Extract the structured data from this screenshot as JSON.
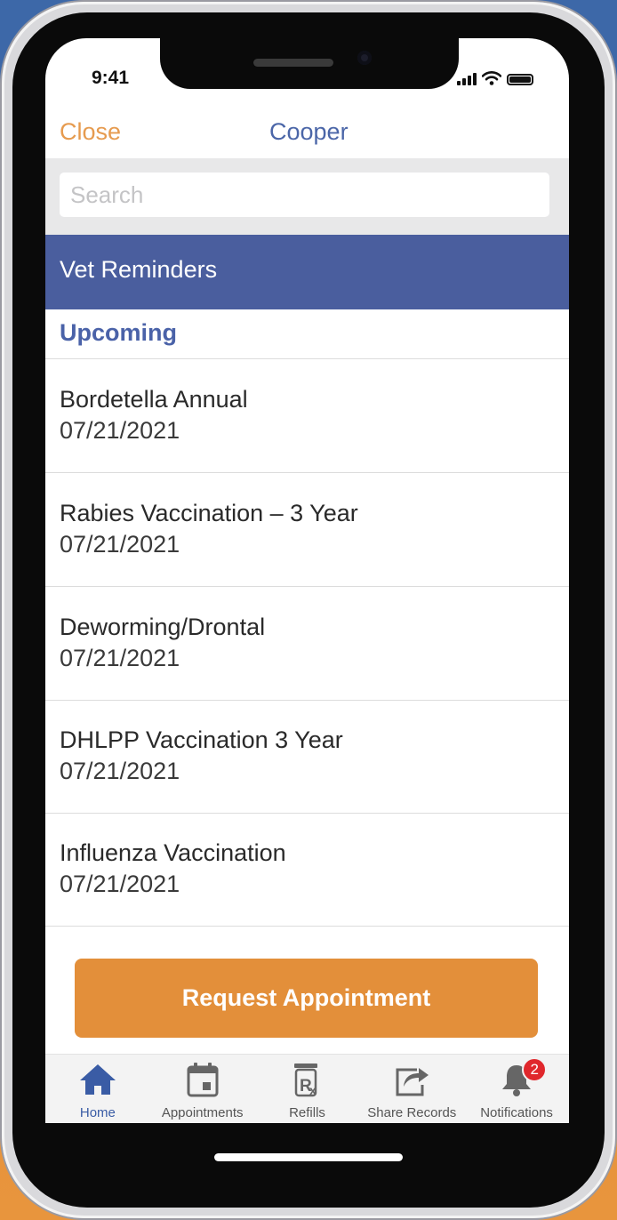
{
  "status_bar": {
    "time": "9:41"
  },
  "nav": {
    "close_label": "Close",
    "title": "Cooper"
  },
  "search": {
    "placeholder": "Search",
    "value": ""
  },
  "section": {
    "title": "Vet Reminders",
    "subheader": "Upcoming"
  },
  "reminders": [
    {
      "title": "Bordetella Annual",
      "date": "07/21/2021"
    },
    {
      "title": "Rabies Vaccination – 3 Year",
      "date": "07/21/2021"
    },
    {
      "title": "Deworming/Drontal",
      "date": "07/21/2021"
    },
    {
      "title": "DHLPP Vaccination 3 Year",
      "date": "07/21/2021"
    },
    {
      "title": "Influenza Vaccination",
      "date": "07/21/2021"
    }
  ],
  "cta": {
    "label": "Request Appointment"
  },
  "tabbar": {
    "tabs": [
      {
        "label": "Home",
        "icon": "home-icon",
        "active": true
      },
      {
        "label": "Appointments",
        "icon": "calendar-icon"
      },
      {
        "label": "Refills",
        "icon": "prescription-icon"
      },
      {
        "label": "Share Records",
        "icon": "share-icon"
      },
      {
        "label": "Notifications",
        "icon": "bell-icon",
        "badge": "2"
      }
    ]
  },
  "colors": {
    "accent_orange": "#e38f3a",
    "header_blue": "#4a5e9e",
    "active_tab": "#3a5ca5",
    "badge_red": "#e0272c"
  }
}
